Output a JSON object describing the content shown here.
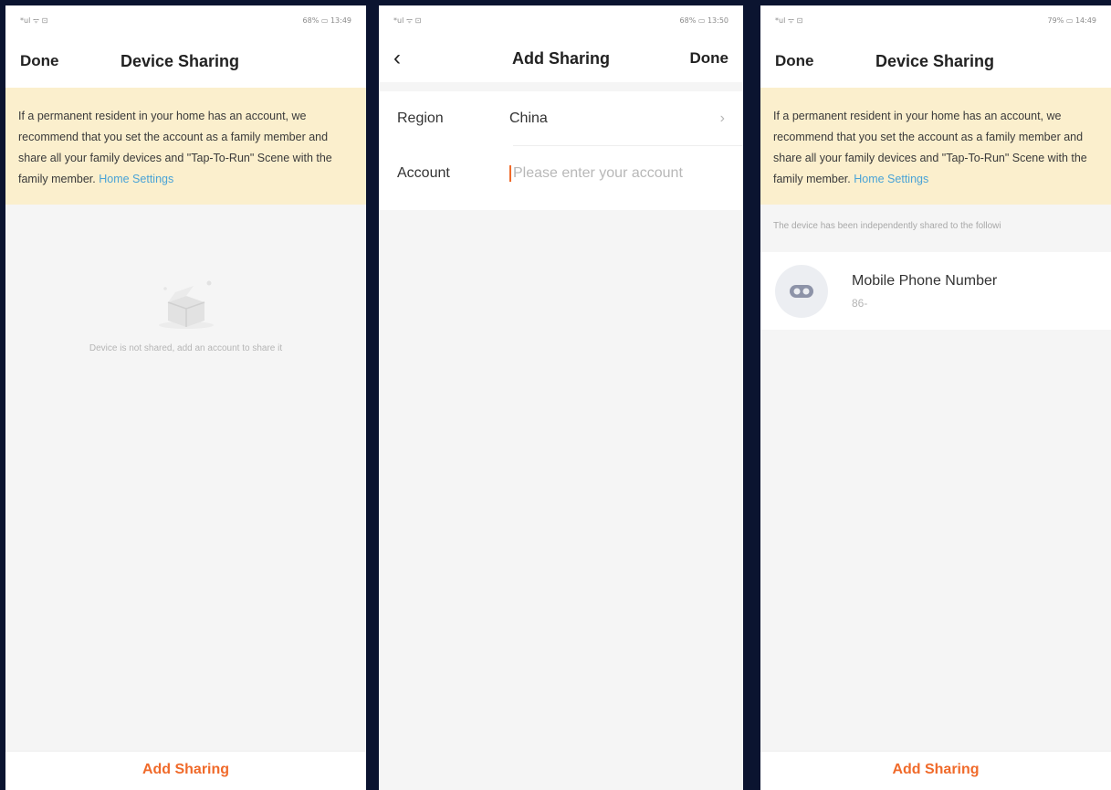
{
  "screen1": {
    "status": {
      "left": "*ul ᯤ ⊡",
      "right": "68% ▭ 13:49"
    },
    "nav": {
      "done_label": "Done",
      "title": "Device Sharing"
    },
    "notice": {
      "text": "If a permanent resident in your home has an account, we recommend that you set the account as a family member and share all your family devices and \"Tap-To-Run\" Scene with the family member.",
      "link": "Home Settings"
    },
    "empty_text": "Device is not shared, add an account to share it",
    "add_sharing_label": "Add Sharing"
  },
  "screen2": {
    "status": {
      "left": "*ul ᯤ ⊡",
      "right": "68% ▭ 13:50"
    },
    "nav": {
      "back_icon": "‹",
      "title": "Add Sharing",
      "done_label": "Done"
    },
    "form": {
      "region_label": "Region",
      "region_value": "China",
      "region_chevron": "›",
      "account_label": "Account",
      "account_placeholder": "Please enter your account"
    }
  },
  "screen3": {
    "status": {
      "left": "*ul ᯤ ⊡",
      "right": "79% ▭ 14:49"
    },
    "nav": {
      "done_label": "Done",
      "title": "Device Sharing"
    },
    "notice": {
      "text": "If a permanent resident in your home has an account, we recommend that you set the account as a family member and share all your family devices and \"Tap-To-Run\" Scene with the family member.",
      "link": "Home Settings"
    },
    "shared_caption": "The device has been independently shared to the followi",
    "shared_item": {
      "name": "Mobile Phone Number",
      "sub": "86-"
    },
    "add_sharing_label": "Add Sharing"
  },
  "colors": {
    "accent": "#f06a2a",
    "notice_bg": "#fbefcd",
    "link": "#4aa3d6",
    "frame": "#0b1430"
  }
}
